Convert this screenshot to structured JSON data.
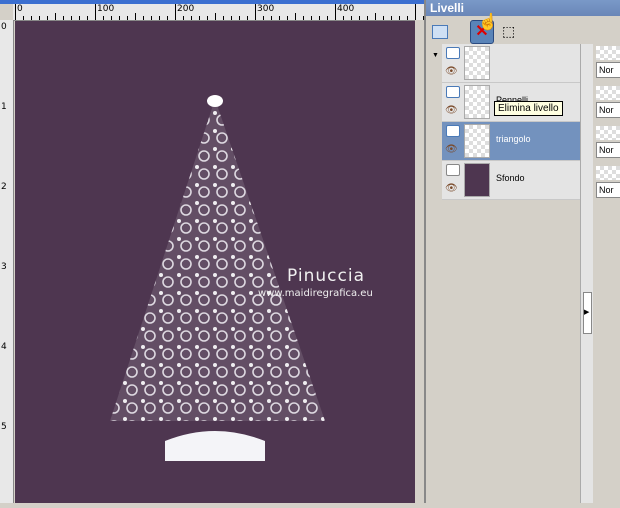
{
  "ruler": {
    "h_labels": [
      "0",
      "100",
      "200",
      "300",
      "400"
    ],
    "v_labels": [
      "0",
      "1",
      "2",
      "3",
      "4",
      "5"
    ]
  },
  "panel": {
    "title": "Livelli",
    "tooltip": "Elimina livello",
    "layers": [
      {
        "name": ""
      },
      {
        "name": "Pennelli"
      },
      {
        "name": "triangolo",
        "selected": true
      },
      {
        "name": "Sfondo"
      }
    ],
    "blend_mode": "Nor"
  },
  "watermark": {
    "line1": "Pinuccia",
    "line2": "www.maidiregrafica.eu"
  },
  "colors": {
    "canvas": "#4e3650",
    "selected_layer": "#7392be",
    "title_bar": "#6a86b8"
  }
}
